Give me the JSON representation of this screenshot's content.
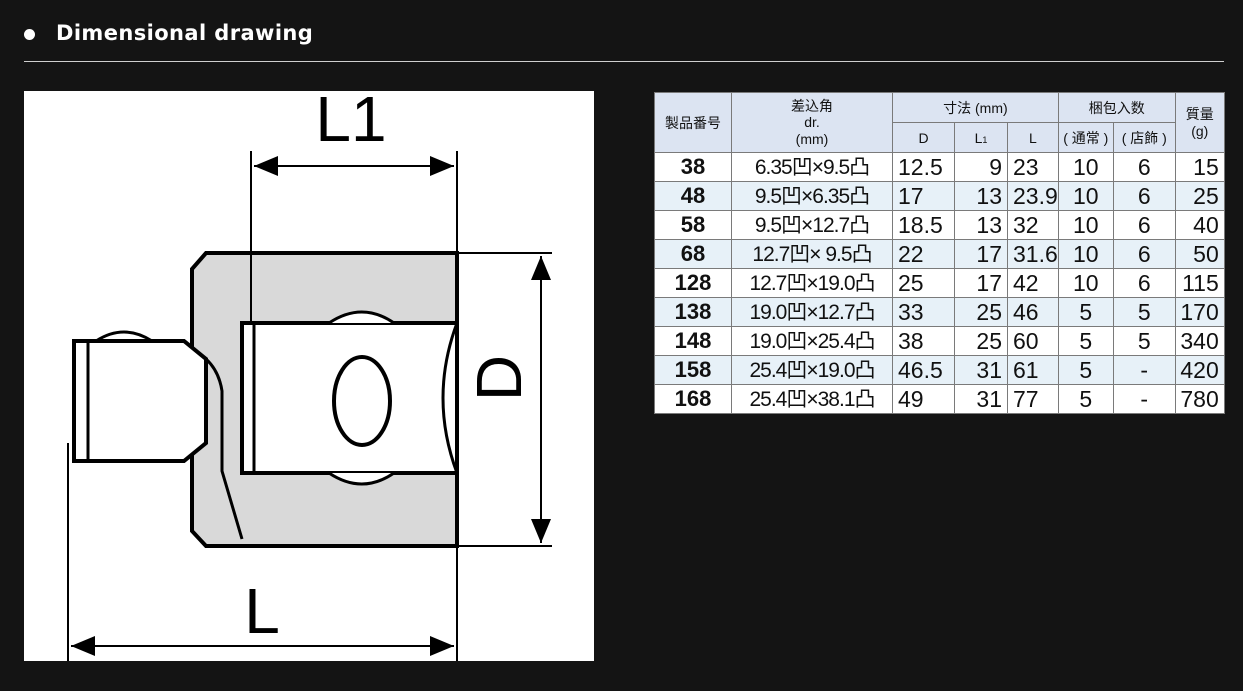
{
  "section": {
    "title": "Dimensional drawing"
  },
  "drawing": {
    "label_L1": "L1",
    "label_D": "D",
    "label_L": "L"
  },
  "table": {
    "headers": {
      "product_no": "製品番号",
      "drive_title": "差込角",
      "drive_dr": "dr.",
      "drive_unit": "(mm)",
      "dimensions": "寸法 (mm)",
      "packing": "梱包入数",
      "mass": "質量",
      "mass_unit": "(g)",
      "D": "D",
      "L1_main": "L",
      "L1_sub": "1",
      "L": "L",
      "normal": "( 通常 )",
      "store": "( 店飾 )"
    },
    "rows": [
      {
        "no": "38",
        "dr": "6.35凹×9.5凸",
        "D": "12.5",
        "L1": "9",
        "L": "23",
        "normal": "10",
        "store": "6",
        "mass": "15"
      },
      {
        "no": "48",
        "dr": "9.5凹×6.35凸",
        "D": "17",
        "L1": "13",
        "L": "23.9",
        "normal": "10",
        "store": "6",
        "mass": "25"
      },
      {
        "no": "58",
        "dr": "9.5凹×12.7凸",
        "D": "18.5",
        "L1": "13",
        "L": "32",
        "normal": "10",
        "store": "6",
        "mass": "40"
      },
      {
        "no": "68",
        "dr": "12.7凹× 9.5凸",
        "D": "22",
        "L1": "17",
        "L": "31.6",
        "normal": "10",
        "store": "6",
        "mass": "50"
      },
      {
        "no": "128",
        "dr": "12.7凹×19.0凸",
        "D": "25",
        "L1": "17",
        "L": "42",
        "normal": "10",
        "store": "6",
        "mass": "115"
      },
      {
        "no": "138",
        "dr": "19.0凹×12.7凸",
        "D": "33",
        "L1": "25",
        "L": "46",
        "normal": "5",
        "store": "5",
        "mass": "170"
      },
      {
        "no": "148",
        "dr": "19.0凹×25.4凸",
        "D": "38",
        "L1": "25",
        "L": "60",
        "normal": "5",
        "store": "5",
        "mass": "340"
      },
      {
        "no": "158",
        "dr": "25.4凹×19.0凸",
        "D": "46.5",
        "L1": "31",
        "L": "61",
        "normal": "5",
        "store": "-",
        "mass": "420"
      },
      {
        "no": "168",
        "dr": "25.4凹×38.1凸",
        "D": "49",
        "L1": "31",
        "L": "77",
        "normal": "5",
        "store": "-",
        "mass": "780"
      }
    ]
  }
}
